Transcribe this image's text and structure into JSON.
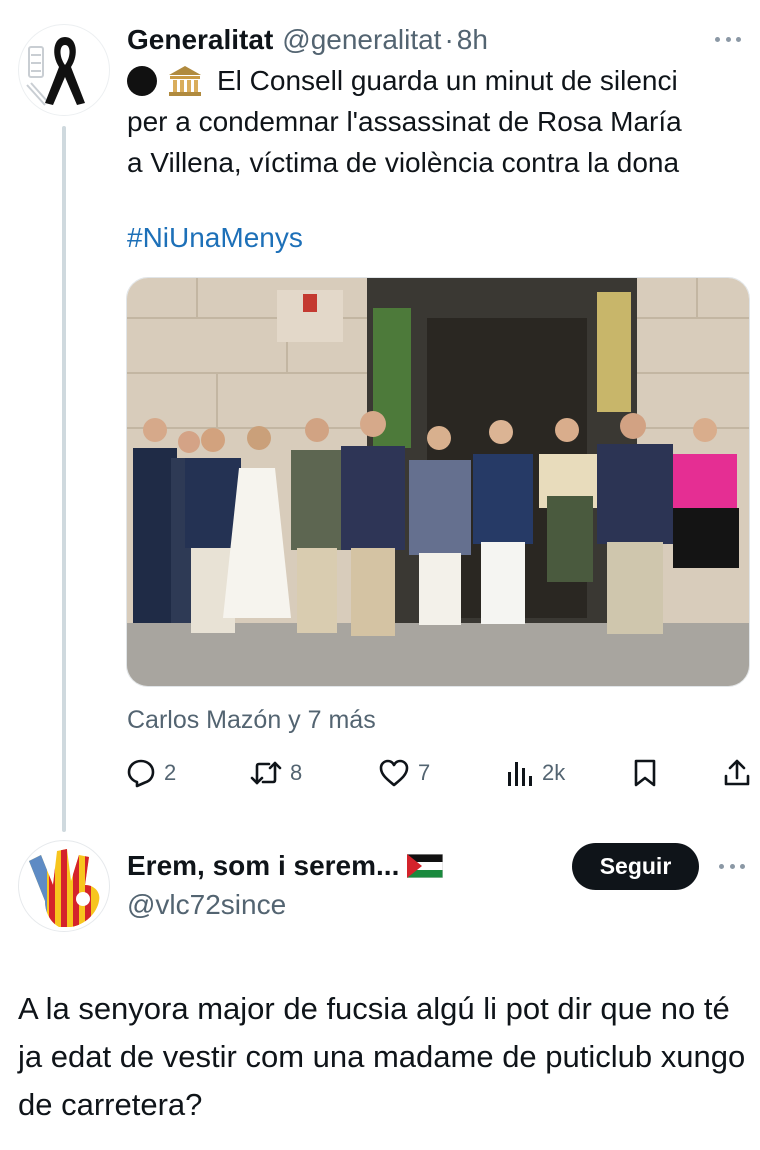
{
  "tweet1": {
    "author_name": "Generalitat",
    "author_handle": "@generalitat",
    "separator": "·",
    "time": "8h",
    "avatar_icon": "black-mourning-ribbon-icon",
    "body_line1": "El Consell guarda un minut de silenci",
    "body_line2": "per a condemnar l'assassinat de Rosa María",
    "body_line3": "a Villena, víctima de violència contra la dona",
    "body_emojis": [
      "black-circle-icon",
      "classical-building-icon"
    ],
    "hashtag": "#NiUnaMenys",
    "photo_alt": "photo-group-minute-of-silence",
    "tagged_people": "Carlos Mazón y 7 más",
    "stats": {
      "replies": "2",
      "reposts": "8",
      "likes": "7",
      "views": "2k"
    }
  },
  "tweet2": {
    "author_name": "Erem, som i serem...",
    "author_handle": "@vlc72since",
    "name_emoji": "palestine-flag-icon",
    "avatar_icon": "senyera-ok-hand-icon",
    "follow_label": "Seguir",
    "body": "A la senyora major de fucsia algú li pot dir que no té ja edat de vestir com una madame de puticlub xungo de carretera?"
  },
  "colors": {
    "text": "#0f1419",
    "secondary": "#536471",
    "link": "#1d70b8",
    "thread_line": "#cfd9de",
    "follow_bg": "#0f1419"
  }
}
